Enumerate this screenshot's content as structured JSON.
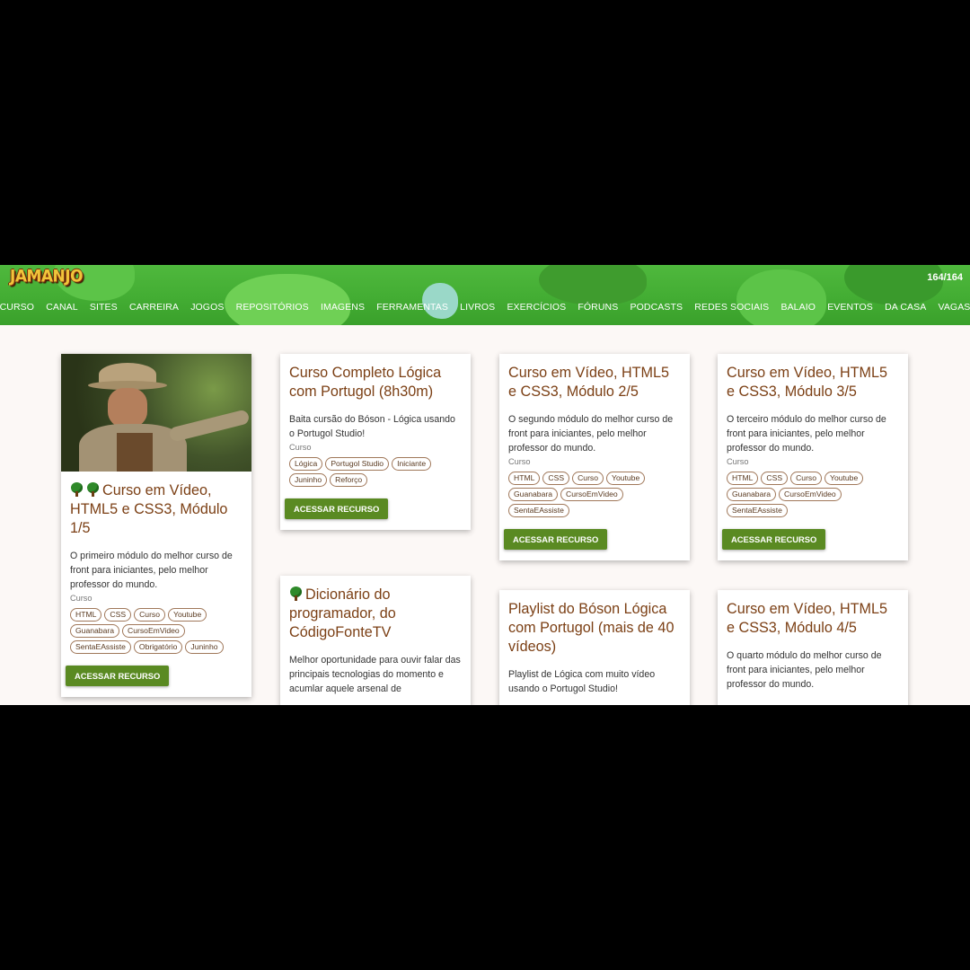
{
  "header": {
    "logo": "JAMANJO",
    "counter": "164/164",
    "nav": [
      "CURSO",
      "CANAL",
      "SITES",
      "CARREIRA",
      "JOGOS",
      "REPOSITÓRIOS",
      "IMAGENS",
      "FERRAMENTAS",
      "LIVROS",
      "EXERCÍCIOS",
      "FÓRUNS",
      "PODCASTS",
      "REDES SOCIAIS",
      "BALAIO",
      "EVENTOS",
      "DA CASA",
      "VAGAS"
    ]
  },
  "cards": [
    {
      "title": "Curso em Vídeo, HTML5 e CSS3, Módulo 1/5",
      "icons": [
        "tree-icon",
        "tree-icon"
      ],
      "description": "O primeiro módulo do melhor curso de front para iniciantes, pelo melhor professor do mundo.",
      "type": "Curso",
      "tags": [
        "HTML",
        "CSS",
        "Curso",
        "Youtube",
        "Guanabara",
        "CursoEmVideo",
        "SentaEAssiste",
        "Obrigatório",
        "Juninho"
      ],
      "button": "ACESSAR RECURSO",
      "image": "explorer-photo"
    },
    {
      "title": "Curso Completo Lógica com Portugol (8h30m)",
      "icons": [],
      "description": "Baita cursão do Bóson - Lógica usando o Portugol Studio!",
      "type": "Curso",
      "tags": [
        "Lógica",
        "Portugol Studio",
        "Iniciante",
        "Juninho",
        "Reforço"
      ],
      "button": "ACESSAR RECURSO"
    },
    {
      "title": "Curso em Vídeo, HTML5 e CSS3, Módulo 2/5",
      "icons": [],
      "description": "O segundo módulo do melhor curso de front para iniciantes, pelo melhor professor do mundo.",
      "type": "Curso",
      "tags": [
        "HTML",
        "CSS",
        "Curso",
        "Youtube",
        "Guanabara",
        "CursoEmVideo",
        "SentaEAssiste"
      ],
      "button": "ACESSAR RECURSO"
    },
    {
      "title": "Curso em Vídeo, HTML5 e CSS3, Módulo 3/5",
      "icons": [],
      "description": "O terceiro módulo do melhor curso de front para iniciantes, pelo melhor professor do mundo.",
      "type": "Curso",
      "tags": [
        "HTML",
        "CSS",
        "Curso",
        "Youtube",
        "Guanabara",
        "CursoEmVideo",
        "SentaEAssiste"
      ],
      "button": "ACESSAR RECURSO"
    },
    {
      "title": "Dicionário do programador, do CódigoFonteTV",
      "icons": [
        "tree-icon"
      ],
      "description": "Melhor oportunidade para ouvir falar das principais tecnologias do momento e acumlar aquele arsenal de",
      "type": "",
      "tags": [],
      "button": ""
    },
    {
      "title": "Playlist do Bóson Lógica com Portugol (mais de 40 vídeos)",
      "icons": [],
      "description": "Playlist de Lógica com muito vídeo usando o Portugol Studio!",
      "type": "",
      "tags": [],
      "button": ""
    },
    {
      "title": "Curso em Vídeo, HTML5 e CSS3, Módulo 4/5",
      "icons": [],
      "description": "O quarto módulo do melhor curso de front para iniciantes, pelo melhor professor do mundo.",
      "type": "",
      "tags": [],
      "button": ""
    }
  ],
  "colors": {
    "header_green": "#43ad33",
    "title_brown": "#7b3f14",
    "button_green": "#5a8a22",
    "page_bg": "#fcf8f6"
  }
}
